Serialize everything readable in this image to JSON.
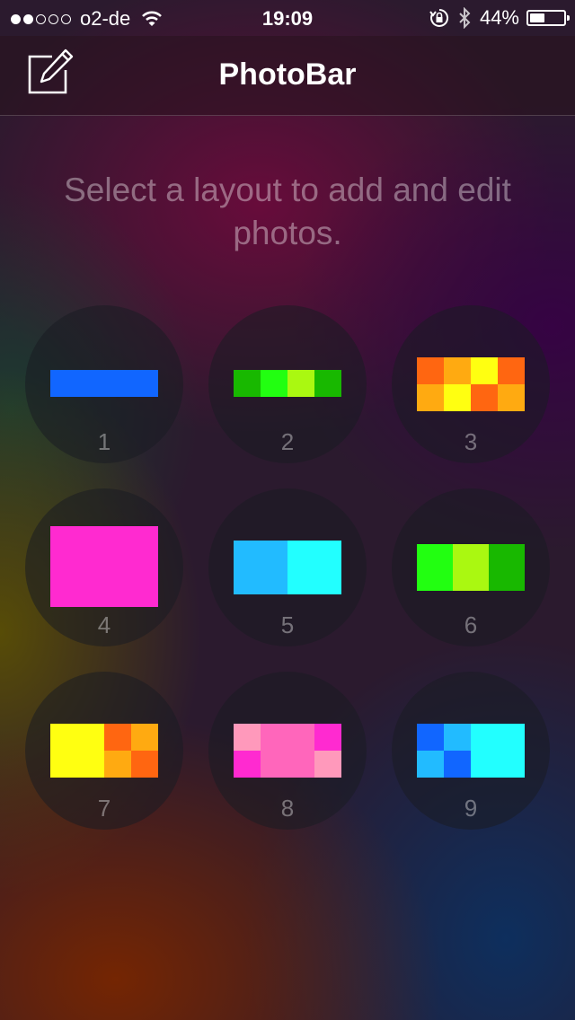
{
  "status_bar": {
    "signal_dots": [
      true,
      true,
      false,
      false,
      false
    ],
    "carrier": "o2-de",
    "time": "19:09",
    "battery_text": "44%",
    "battery_level": 0.44,
    "icons": [
      "wifi-icon",
      "rotation-lock-icon",
      "bluetooth-icon",
      "battery-icon"
    ]
  },
  "nav": {
    "title": "PhotoBar",
    "compose_icon": "compose-icon"
  },
  "prompt": "Select a layout to add and edit photos.",
  "colors": {
    "blue": "#1166ff",
    "green_dark": "#18b800",
    "green_bright": "#22ff11",
    "lime": "#aaf811",
    "orange": "#ff6611",
    "amber": "#ffaa11",
    "yellow": "#ffff11",
    "magenta": "#ff2ad0",
    "sky": "#22bbff",
    "cyan": "#22ffff",
    "pink": "#ff66bb",
    "light_pink": "#ff99bb"
  },
  "layouts": [
    {
      "label": "1"
    },
    {
      "label": "2"
    },
    {
      "label": "3"
    },
    {
      "label": "4"
    },
    {
      "label": "5"
    },
    {
      "label": "6"
    },
    {
      "label": "7"
    },
    {
      "label": "8"
    },
    {
      "label": "9"
    }
  ]
}
